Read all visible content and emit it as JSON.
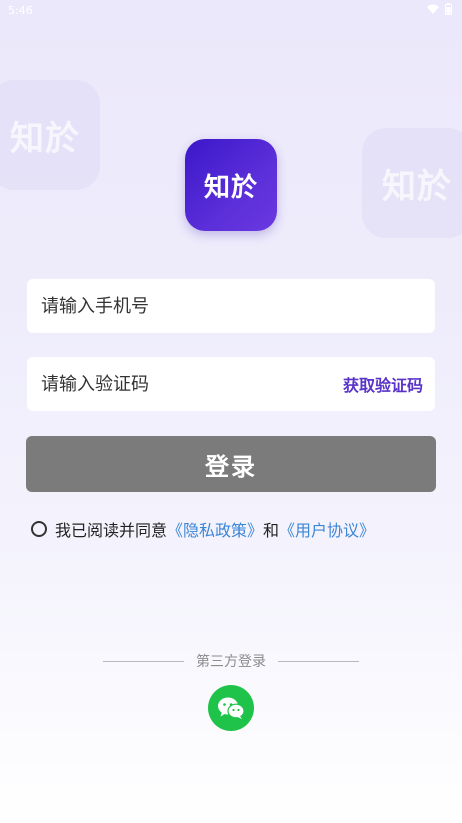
{
  "status_bar": {
    "time": "5:46"
  },
  "watermark": {
    "text": "知於"
  },
  "logo": {
    "text": "知於"
  },
  "form": {
    "phone_placeholder": "请输入手机号",
    "code_placeholder": "请输入验证码",
    "get_code_label": "获取验证码"
  },
  "login_button": {
    "label": "登录"
  },
  "agreement": {
    "prefix": "我已阅读并同意",
    "privacy_link": "《隐私政策》",
    "conjunction": "和",
    "user_link": "《用户协议》"
  },
  "third_party": {
    "label": "第三方登录"
  },
  "colors": {
    "accent": "#5A33C8",
    "link": "#3C86D6",
    "button": "#7B7B7B",
    "wechat": "#1FC34A"
  },
  "icons": [
    "wifi-icon",
    "battery-icon",
    "radio-unchecked-icon",
    "wechat-icon"
  ]
}
